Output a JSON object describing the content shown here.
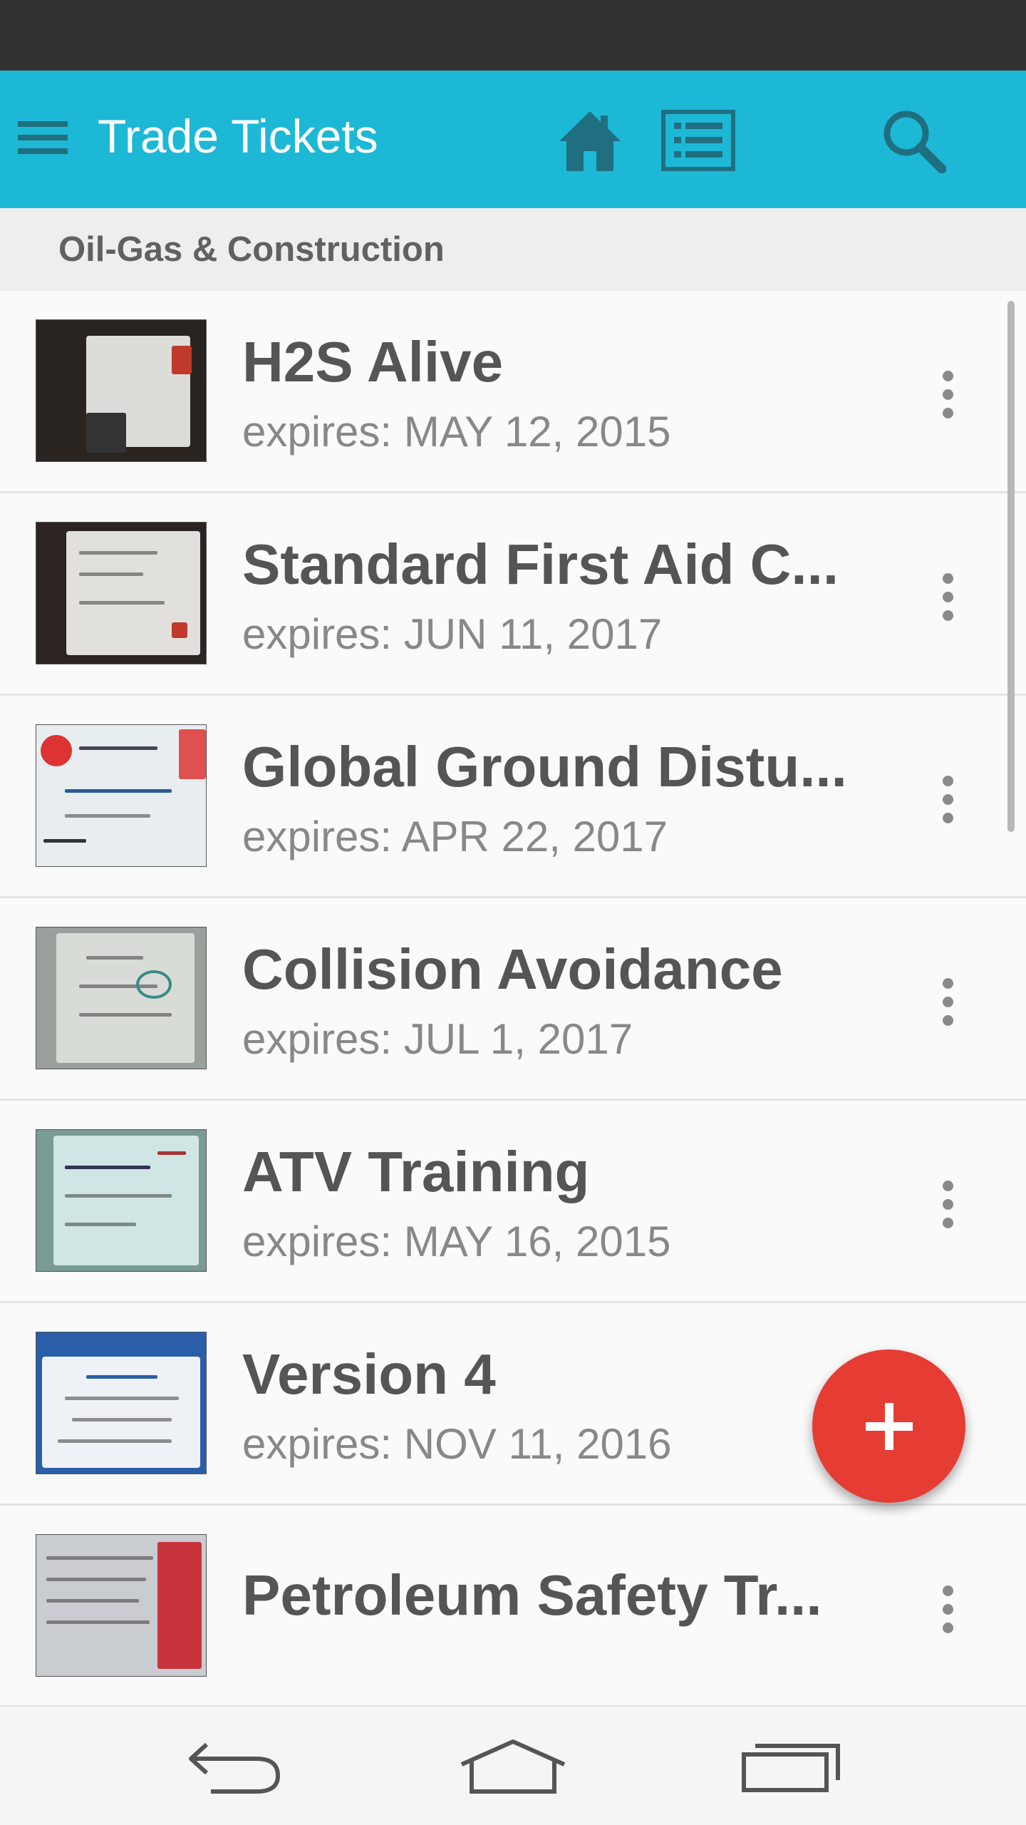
{
  "app_bar": {
    "title": "Trade Tickets",
    "background_color": "#1db8d6",
    "icons": [
      "menu-icon",
      "home-icon",
      "list-icon",
      "search-icon"
    ]
  },
  "section": {
    "title": "Oil-Gas & Construction"
  },
  "items": [
    {
      "title": "H2S Alive",
      "subtitle": "expires: MAY 12, 2015"
    },
    {
      "title": "Standard First Aid C...",
      "subtitle": "expires: JUN 11, 2017"
    },
    {
      "title": "Global Ground Distu...",
      "subtitle": "expires: APR 22, 2017"
    },
    {
      "title": "Collision Avoidance",
      "subtitle": "expires: JUL 1, 2017"
    },
    {
      "title": "ATV Training",
      "subtitle": "expires: MAY 16, 2015"
    },
    {
      "title": "Version 4",
      "subtitle": "expires: NOV 11, 2016"
    },
    {
      "title": "Petroleum Safety Tr...",
      "subtitle": ""
    }
  ],
  "fab": {
    "icon": "plus-icon",
    "color": "#e53d33"
  },
  "nav_bar": {
    "icons": [
      "back-icon",
      "home-icon",
      "recent-apps-icon"
    ]
  }
}
